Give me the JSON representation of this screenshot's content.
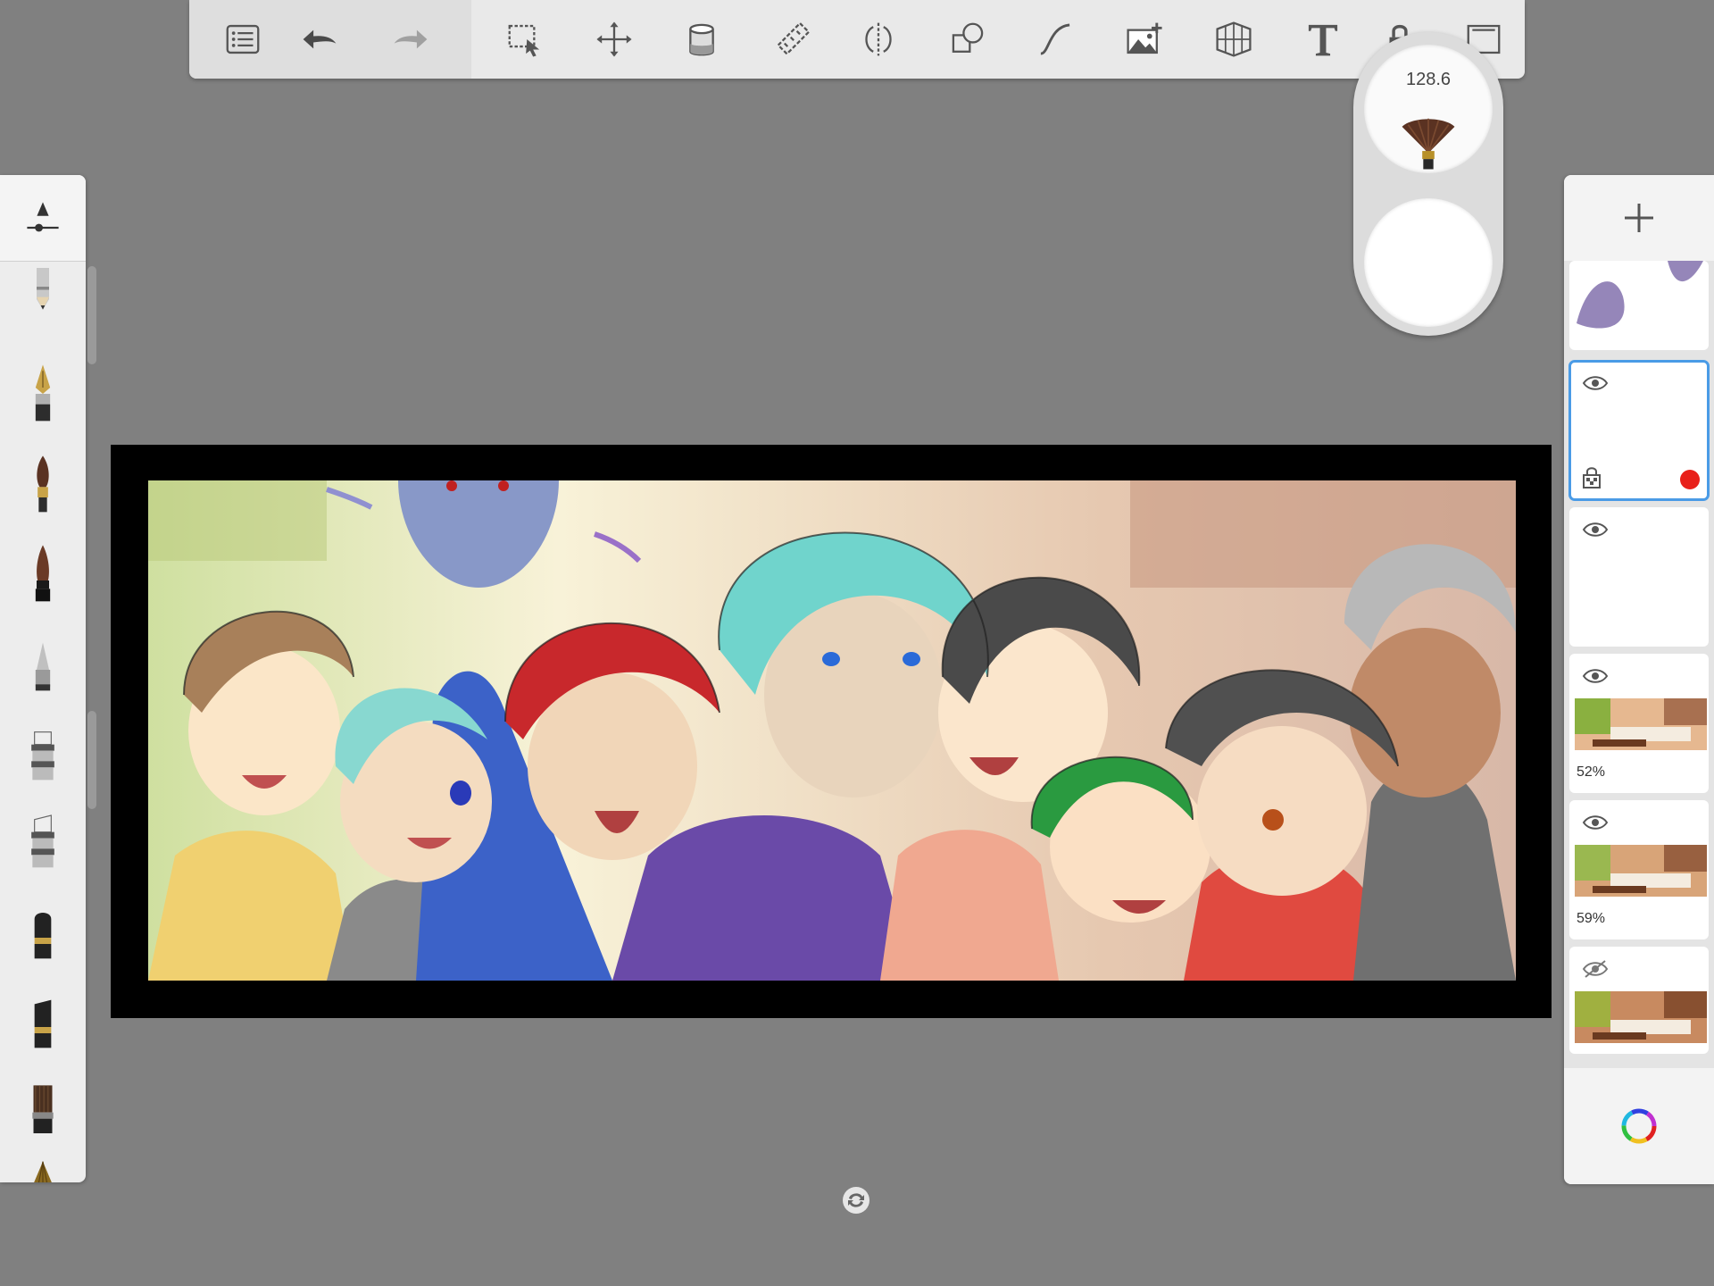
{
  "toolbar": {
    "tools": [
      "list-icon",
      "undo-icon",
      "redo-icon",
      "selection-icon",
      "transform-icon",
      "fill-icon",
      "ruler-icon",
      "symmetry-icon",
      "shapes-icon",
      "curve-icon",
      "image-import-icon",
      "perspective-icon",
      "text-icon",
      "lock-icon",
      "fullscreen-icon"
    ]
  },
  "brush_puck": {
    "size_value": "128.6",
    "opacity_color": "#ffffff"
  },
  "brush_palette": {
    "brushes": [
      "pencil-brush-icon",
      "fountain-pen-brush-icon",
      "paint-brush-icon",
      "ink-brush-icon",
      "airbrush-brush-icon",
      "marker-brush-icon",
      "marker-alt-brush-icon",
      "eraser-brush-icon",
      "eraser-hard-brush-icon",
      "bristle-brush-icon",
      "fan-brush-icon"
    ]
  },
  "layers": {
    "items": [
      {
        "name": "layer-sketch-partial",
        "visible": true,
        "opacity_label": ""
      },
      {
        "name": "layer-empty-selected",
        "visible": true,
        "selected": true,
        "locked": true,
        "color": "#e8201a",
        "opacity_label": ""
      },
      {
        "name": "layer-empty",
        "visible": true,
        "opacity_label": ""
      },
      {
        "name": "layer-background-a",
        "visible": true,
        "opacity_label": "52%"
      },
      {
        "name": "layer-background-b",
        "visible": true,
        "opacity_label": "59%"
      },
      {
        "name": "layer-background-c",
        "visible": false,
        "opacity_label": ""
      }
    ]
  },
  "colors": {
    "accent": "#4a9be6",
    "layer_tag": "#e8201a",
    "ui_gray": "#808080"
  }
}
